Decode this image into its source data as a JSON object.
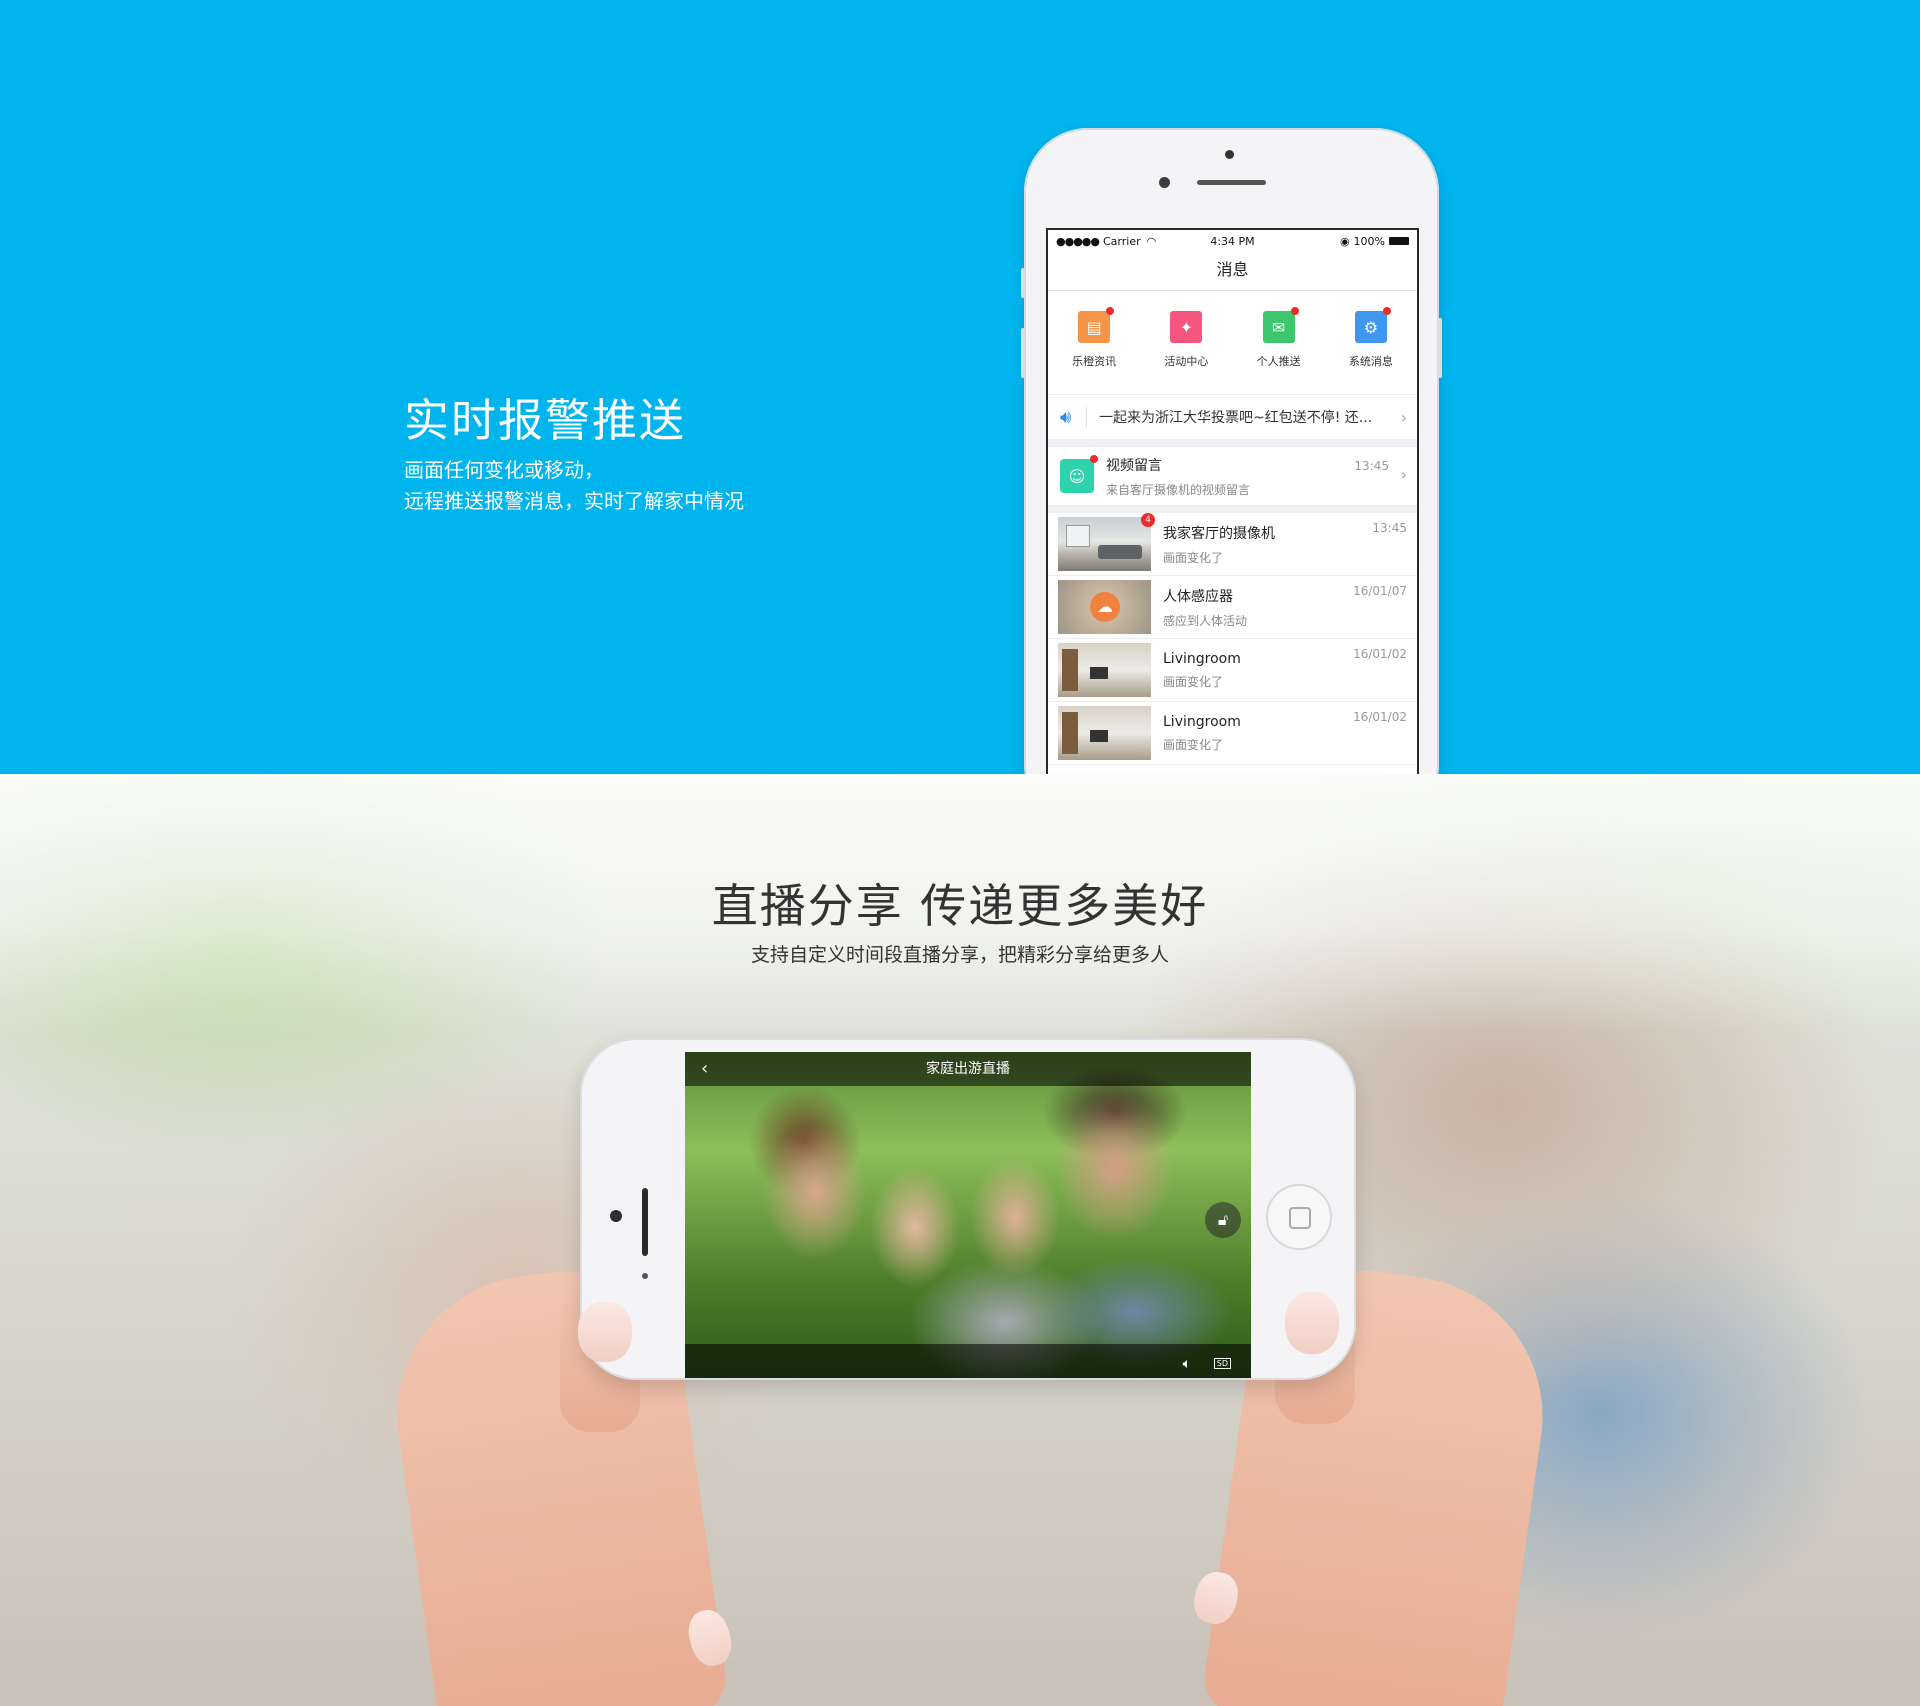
{
  "section1": {
    "title": "实时报警推送",
    "desc_line1": "画面任何变化或移动，",
    "desc_line2": "远程推送报警消息，实时了解家中情况"
  },
  "phone1": {
    "status": {
      "carrier": "Carrier",
      "time": "4:34 PM",
      "battery": "100%"
    },
    "nav_title": "消息",
    "icons": [
      {
        "label": "乐橙资讯",
        "color": "#f69548",
        "glyph": "news-icon"
      },
      {
        "label": "活动中心",
        "color": "#f4567e",
        "glyph": "party-icon"
      },
      {
        "label": "个人推送",
        "color": "#3ec66c",
        "glyph": "mail-icon"
      },
      {
        "label": "系统消息",
        "color": "#3f97f0",
        "glyph": "gear-icon"
      }
    ],
    "notice": "一起来为浙江大华投票吧~红包送不停! 还...",
    "video_msg": {
      "title": "视频留言",
      "sub": "来自客厅摄像机的视频留言",
      "time": "13:45"
    },
    "messages": [
      {
        "title": "我家客厅的摄像机",
        "sub": "画面变化了",
        "time": "13:45",
        "badge": "4"
      },
      {
        "title": "人体感应器",
        "sub": "感应到人体活动",
        "time": "16/01/07"
      },
      {
        "title": "Livingroom",
        "sub": "画面变化了",
        "time": "16/01/02"
      },
      {
        "title": "Livingroom",
        "sub": "画面变化了",
        "time": "16/01/02"
      }
    ]
  },
  "section2": {
    "title": "直播分享  传递更多美好",
    "desc": "支持自定义时间段直播分享，把精彩分享给更多人"
  },
  "phone2": {
    "screen_title": "家庭出游直播",
    "sd_label": "SD"
  }
}
